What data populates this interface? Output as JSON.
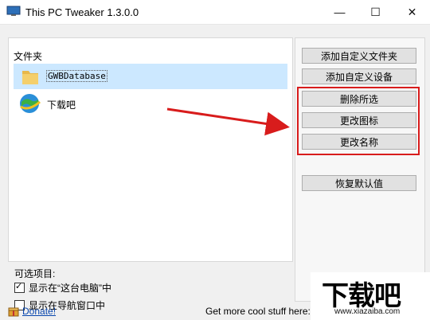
{
  "window": {
    "title": "This PC Tweaker 1.3.0.0",
    "controls": {
      "minimize": "—",
      "maximize": "☐",
      "close": "✕"
    }
  },
  "folders_group": {
    "label": "文件夹",
    "items": [
      {
        "label": "GWBDatabase",
        "selected": true,
        "icon": "folder-icon"
      },
      {
        "label": "下载吧",
        "selected": false,
        "icon": "globe-icon"
      }
    ]
  },
  "options": {
    "title": "可选项目:",
    "checkboxes": [
      {
        "label": "显示在“这台电脑”中",
        "checked": true
      },
      {
        "label": "显示在导航窗口中",
        "checked": false
      }
    ]
  },
  "buttons": {
    "add_custom_folder": "添加自定义文件夹",
    "add_custom_device": "添加自定义设备",
    "delete_selected": "删除所选",
    "change_icon": "更改图标",
    "change_name": "更改名称",
    "restore_default": "恢复默认值"
  },
  "footer": {
    "donate": "Donate!",
    "more_stuff": "Get more cool stuff here: W"
  },
  "watermark": {
    "big": "下载吧",
    "small": "www.xiazaiba.com"
  },
  "colors": {
    "highlight": "#d81c1c",
    "selection": "#cce8ff",
    "link": "#0645ad"
  }
}
